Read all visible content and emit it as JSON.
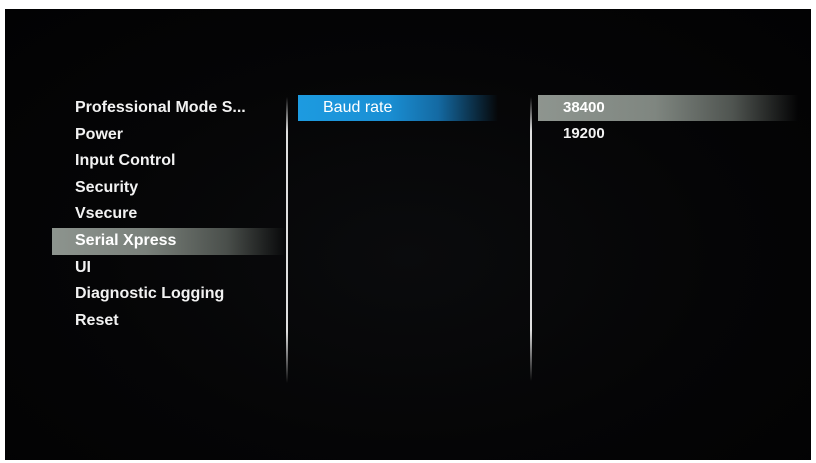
{
  "settings_menu": {
    "items": [
      {
        "label": "Professional Mode S..."
      },
      {
        "label": "Power"
      },
      {
        "label": "Input Control"
      },
      {
        "label": "Security"
      },
      {
        "label": "Vsecure"
      },
      {
        "label": "Serial Xpress"
      },
      {
        "label": "UI"
      },
      {
        "label": "Diagnostic Logging"
      },
      {
        "label": "Reset"
      }
    ],
    "selected_index": 5
  },
  "submenu": {
    "items": [
      {
        "label": "Baud rate"
      }
    ],
    "selected_index": 0
  },
  "options": {
    "items": [
      {
        "label": "38400"
      },
      {
        "label": "19200"
      }
    ],
    "selected_index": 0
  },
  "colors": {
    "background": "#050506",
    "highlight_gray": "#8d948e",
    "highlight_blue": "#1d9be0",
    "text": "#f2f2f2"
  }
}
